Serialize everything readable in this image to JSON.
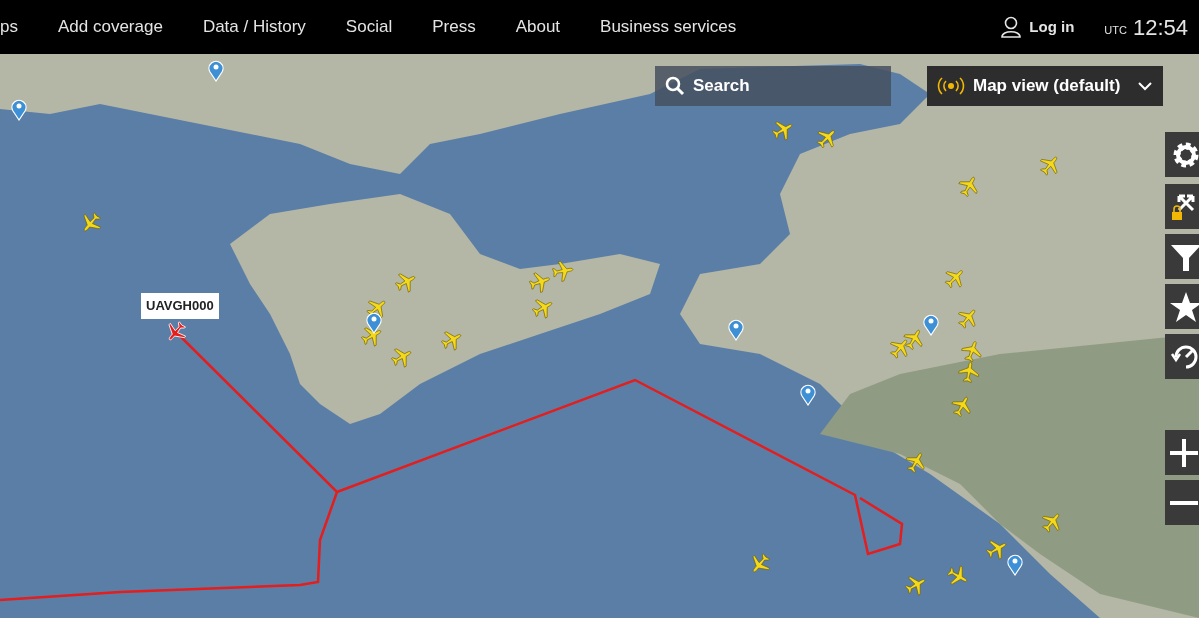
{
  "nav": {
    "items": [
      {
        "label": "ps"
      },
      {
        "label": "Add coverage"
      },
      {
        "label": "Data / History"
      },
      {
        "label": "Social"
      },
      {
        "label": "Press"
      },
      {
        "label": "About"
      },
      {
        "label": "Business services"
      }
    ],
    "login": "Log in",
    "timezone": "UTC",
    "time": "12:54"
  },
  "search": {
    "placeholder": "Search"
  },
  "map_view": {
    "value": "Map view (default)"
  },
  "map": {
    "selected_flight": {
      "callsign": "UAVGH000"
    }
  }
}
